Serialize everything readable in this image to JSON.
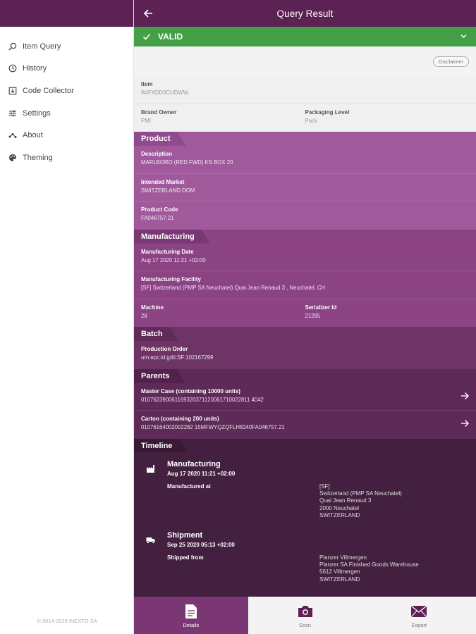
{
  "sidebar": {
    "items": [
      {
        "label": "Item Query",
        "icon": "search-icon"
      },
      {
        "label": "History",
        "icon": "history-icon"
      },
      {
        "label": "Code Collector",
        "icon": "code-collector-icon"
      },
      {
        "label": "Settings",
        "icon": "settings-icon"
      },
      {
        "label": "About",
        "icon": "about-icon"
      },
      {
        "label": "Theming",
        "icon": "palette-icon"
      }
    ],
    "copyright": "© 2014-2019 INEXTO SA"
  },
  "header": {
    "title": "Query Result"
  },
  "status": {
    "label": "VALID",
    "color": "#43a047"
  },
  "disclaimer": {
    "label": "Disclaimer"
  },
  "item": {
    "label": "Item",
    "value": "R4FXDD3CUDWW"
  },
  "brand_owner": {
    "label": "Brand Owner",
    "value": "PMI"
  },
  "packaging_level": {
    "label": "Packaging Level",
    "value": "Pack"
  },
  "product": {
    "title": "Product",
    "description": {
      "label": "Description",
      "value": "MARLBORO (RED FWD) KS BOX 20"
    },
    "intended_market": {
      "label": "Intended Market",
      "value": "SWITZERLAND DOM"
    },
    "product_code": {
      "label": "Product Code",
      "value": "FA046757.21"
    }
  },
  "manufacturing": {
    "title": "Manufacturing",
    "date": {
      "label": "Manufacturing Date",
      "value": "Aug 17 2020 11:21 +02:00"
    },
    "facility": {
      "label": "Manufacturing Facility",
      "value": "[SF] Switzerland (PMP SA Neuchatel) Quai Jean Renaud 3 , Neuchatel, CH"
    },
    "machine": {
      "label": "Machine",
      "value": "28"
    },
    "serializer": {
      "label": "Serializer Id",
      "value": "21285"
    }
  },
  "batch": {
    "title": "Batch",
    "production_order": {
      "label": "Production Order",
      "value": "urn:epc:id:gdti:SF:102167299"
    }
  },
  "parents": {
    "title": "Parents",
    "master_case": {
      "label": "Master Case (containing 10000 units)",
      "value": "010762390061169320371120061710022811 4042"
    },
    "carton": {
      "label": "Carton (containing 200 units)",
      "value": "01076164002002282 15MFWYQZQFLH8240FA046757.21"
    }
  },
  "timeline": {
    "title": "Timeline",
    "events": [
      {
        "title": "Manufacturing",
        "date": "Aug 17 2020 11:21 +02:00",
        "detail_label": "Manufactured at",
        "lines": [
          "[SF]",
          "Switzerland (PMP SA Neuchatel)",
          "Quai Jean Renaud 3",
          "2000 Neuchatel",
          "SWITZERLAND"
        ]
      },
      {
        "title": "Shipment",
        "date": "Sep 25 2020 05:13 +02:00",
        "detail_label": "Shipped from",
        "lines": [
          "Planzer Villmergen",
          "Planzer SA Finished Goods Warehouse",
          "5612 Villmergen",
          "SWITZERLAND"
        ]
      }
    ]
  },
  "bottom_nav": {
    "details": "Details",
    "scan": "Scan",
    "export": "Export"
  },
  "colors": {
    "brand": "#5c2253",
    "valid": "#43a047"
  }
}
